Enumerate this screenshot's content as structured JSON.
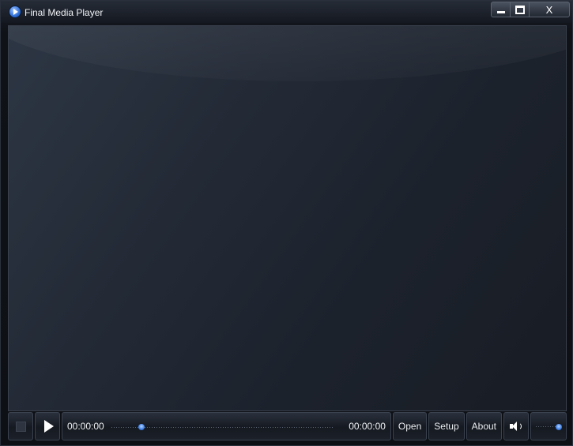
{
  "window": {
    "title": "Final Media Player",
    "icon": "play-circle-icon",
    "controls": {
      "minimize_icon": "minimize-icon",
      "maximize_icon": "maximize-icon",
      "close_label": "X"
    }
  },
  "video": {
    "state": "empty"
  },
  "controls": {
    "stop_icon": "stop-icon",
    "play_icon": "play-icon",
    "elapsed_time": "00:00:00",
    "total_time": "00:00:00",
    "seek_position": 0,
    "open_label": "Open",
    "setup_label": "Setup",
    "about_label": "About",
    "volume_icon": "speaker-icon",
    "volume_level": 1.0
  },
  "colors": {
    "accent": "#3a7ee6",
    "background": "#0d1015",
    "video_area": "#232a36"
  }
}
